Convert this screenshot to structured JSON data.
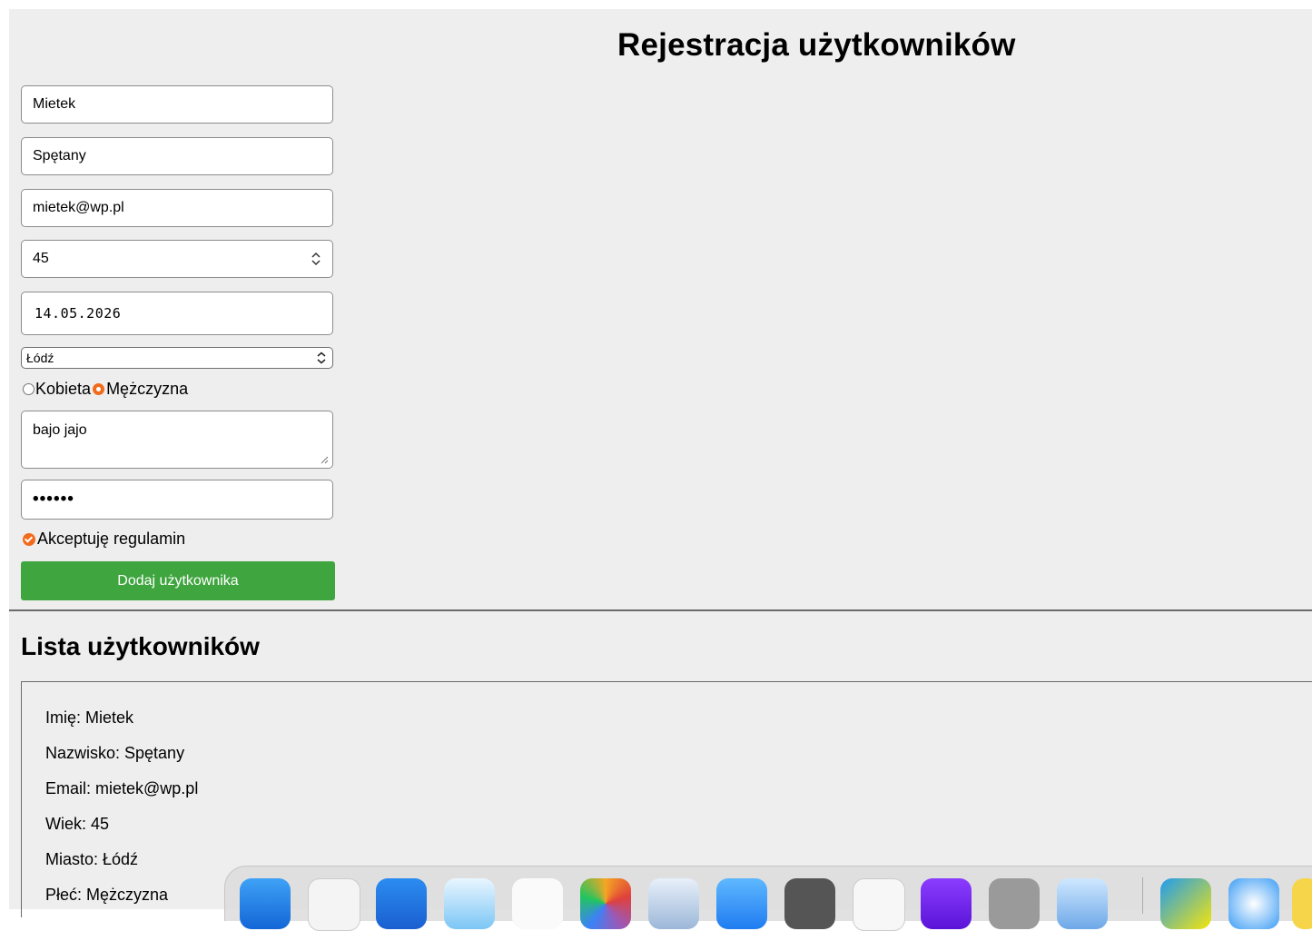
{
  "page_title": "Rejestracja użytkowników",
  "form": {
    "first_name": "Mietek",
    "last_name": "Spętany",
    "email": "mietek@wp.pl",
    "age": "45",
    "date": "14.05.2026",
    "city": "Łódź",
    "gender_options": [
      {
        "label": "Kobieta",
        "selected": false
      },
      {
        "label": "Mężczyzna",
        "selected": true
      }
    ],
    "notes": "bajo jajo",
    "password_mask": "••••••",
    "terms_label": "Akceptuję regulamin",
    "terms_checked": true,
    "submit_label": "Dodaj użytkownika"
  },
  "list": {
    "title": "Lista użytkowników",
    "entry": {
      "name": "Imię: Mietek",
      "surname": "Nazwisko: Spętany",
      "email": "Email: mietek@wp.pl",
      "age": "Wiek: 45",
      "city": "Miasto: Łódź",
      "gender": "Płeć: Mężczyzna"
    }
  },
  "colors": {
    "accent": "#f26b1d",
    "button": "#3fa53f",
    "background": "#eeeeee"
  },
  "dock": {
    "icons": [
      "app-store-icon",
      "finder-icon",
      "xcode-icon",
      "preview-icon",
      "numbers-icon",
      "photos-icon",
      "keynote-icon",
      "mail-icon",
      "activity-icon",
      "books-icon",
      "imovie-icon",
      "settings-icon",
      "disk-icon",
      "webstorm-icon",
      "safari-icon",
      "notes-icon"
    ]
  }
}
